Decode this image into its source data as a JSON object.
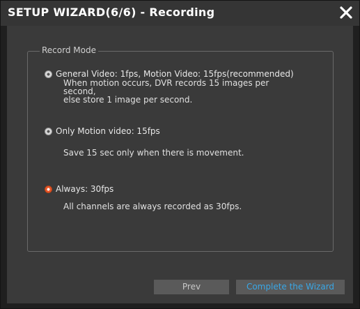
{
  "window": {
    "title": "SETUP WIZARD(6/6) - Recording",
    "close_icon": "close-icon"
  },
  "record_mode": {
    "legend": "Record Mode",
    "options": [
      {
        "label": "General Video: 1fps, Motion Video: 15fps(recommended)",
        "selected": false,
        "description_lines": [
          "When motion occurs, DVR records 15 images per",
          "second,",
          "else store 1 image per second."
        ]
      },
      {
        "label": "Only Motion video: 15fps",
        "selected": false,
        "description_lines": [
          "Save 15 sec only when there is movement."
        ]
      },
      {
        "label": "Always: 30fps",
        "selected": true,
        "description_lines": [
          "All channels are always recorded as 30fps."
        ]
      }
    ]
  },
  "buttons": {
    "prev_label": "Prev",
    "complete_label": "Complete the Wizard"
  },
  "colors": {
    "accent_selected_radio": "#e8582a",
    "complete_button_text": "#39a7e6"
  }
}
